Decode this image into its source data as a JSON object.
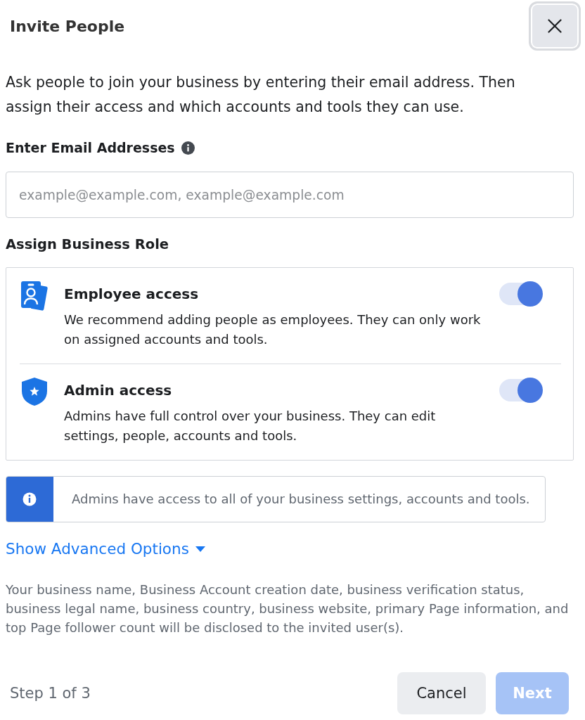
{
  "dialog": {
    "title": "Invite People"
  },
  "intro": "Ask people to join your business by entering their email address. Then assign their access and which accounts and tools they can use.",
  "email": {
    "label": "Enter Email Addresses",
    "placeholder": "example@example.com, example@example.com"
  },
  "business_role": {
    "heading": "Assign Business Role",
    "roles": [
      {
        "kind": "employee",
        "title": "Employee access",
        "description": "We recommend adding people as employees. They can only work on assigned accounts and tools.",
        "on": true
      },
      {
        "kind": "admin",
        "title": "Admin access",
        "description": "Admins have full control over your business. They can edit settings, people, accounts and tools.",
        "on": true
      }
    ]
  },
  "notice": {
    "text": "Admins have access to all of your business settings, accounts and tools."
  },
  "advanced_options": {
    "label": "Show Advanced Options",
    "expanded": false
  },
  "disclosure": "Your business name, Business Account creation date, business verification status, business legal name, business country, business website, primary Page information, and top Page follower count will be disclosed to the invited user(s).",
  "footer": {
    "step": "Step 1 of 3",
    "buttons": [
      {
        "kind": "secondary",
        "label": "Cancel",
        "disabled": false
      },
      {
        "kind": "primary",
        "label": "Next",
        "disabled": true
      }
    ]
  }
}
